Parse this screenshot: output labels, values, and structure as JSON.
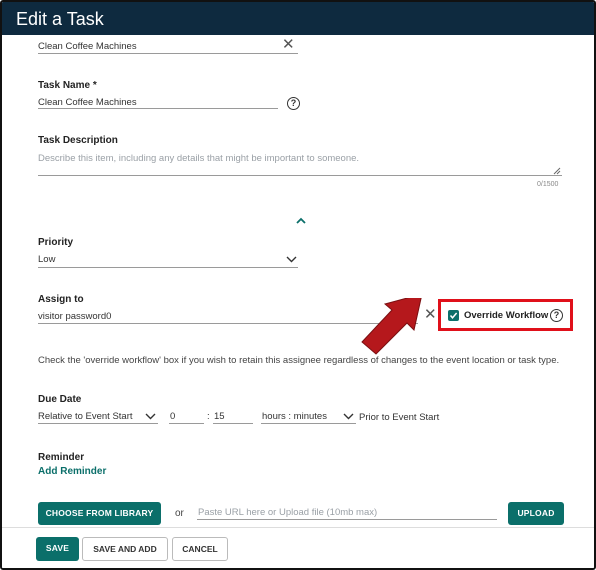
{
  "window": {
    "title": "Edit a Task"
  },
  "top_field": {
    "value": "Clean Coffee Machines"
  },
  "task_name": {
    "label": "Task Name *",
    "value": "Clean Coffee Machines"
  },
  "task_description": {
    "label": "Task Description",
    "placeholder": "Describe this item, including any details that might be important to someone.",
    "counter": "0/1500"
  },
  "priority": {
    "label": "Priority",
    "value": "Low"
  },
  "assign_to": {
    "label": "Assign to",
    "value": "visitor password0"
  },
  "override_workflow": {
    "label": "Override Workflow",
    "checked": true
  },
  "hint_text": "Check the 'override workflow' box if you wish to retain this assignee regardless of changes to the event location or task type.",
  "due_date": {
    "label": "Due Date",
    "relative_select": "Relative to Event Start",
    "hours": "0",
    "separator": ":",
    "minutes": "15",
    "unit_select": "hours : minutes",
    "suffix": "Prior to Event Start"
  },
  "reminder": {
    "label": "Reminder",
    "add_link": "Add Reminder"
  },
  "attachment": {
    "library_button": "CHOOSE FROM LIBRARY",
    "or_text": "or",
    "url_placeholder": "Paste URL here or Upload file (10mb max)",
    "upload_button": "UPLOAD"
  },
  "footer": {
    "save": "SAVE",
    "save_and_add": "SAVE AND ADD",
    "cancel": "CANCEL"
  },
  "colors": {
    "title_bar": "#0e2a3f",
    "accent": "#0b6f6a",
    "highlight_box": "#e0101a",
    "arrow": "#b5181c"
  },
  "icons": [
    "close-icon",
    "help-icon",
    "chevron-up-icon",
    "chevron-down-icon",
    "checkbox-icon",
    "annotation-arrow"
  ]
}
